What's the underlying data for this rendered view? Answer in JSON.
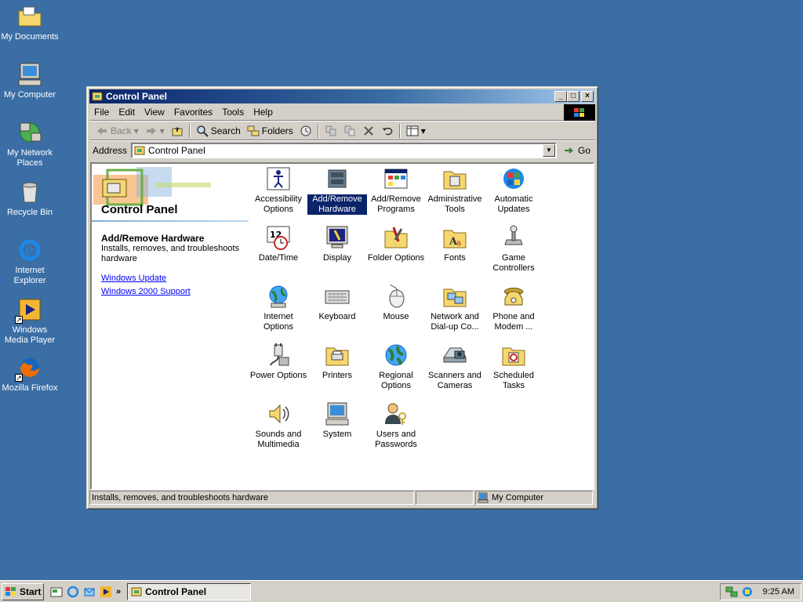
{
  "desktop": {
    "icons": [
      {
        "label": "My Documents"
      },
      {
        "label": "My Computer"
      },
      {
        "label": "My Network Places"
      },
      {
        "label": "Recycle Bin"
      },
      {
        "label": "Internet Explorer"
      },
      {
        "label": "Windows Media Player"
      },
      {
        "label": "Mozilla Firefox"
      }
    ]
  },
  "window": {
    "title": "Control Panel",
    "menu": [
      "File",
      "Edit",
      "View",
      "Favorites",
      "Tools",
      "Help"
    ],
    "toolbar": {
      "back": "Back",
      "search": "Search",
      "folders": "Folders"
    },
    "address": {
      "label": "Address",
      "value": "Control Panel",
      "go": "Go"
    },
    "left_pane": {
      "title": "Control Panel",
      "selected_title": "Add/Remove Hardware",
      "selected_desc": "Installs, removes, and troubleshoots hardware",
      "links": [
        "Windows Update",
        "Windows 2000 Support"
      ]
    },
    "items": [
      {
        "label": "Accessibility Options",
        "icon": "accessibility-icon"
      },
      {
        "label": "Add/Remove Hardware",
        "icon": "hardware-icon",
        "selected": true
      },
      {
        "label": "Add/Remove Programs",
        "icon": "programs-icon"
      },
      {
        "label": "Administrative Tools",
        "icon": "admin-tools-icon"
      },
      {
        "label": "Automatic Updates",
        "icon": "windows-update-icon"
      },
      {
        "label": "Date/Time",
        "icon": "datetime-icon"
      },
      {
        "label": "Display",
        "icon": "display-icon"
      },
      {
        "label": "Folder Options",
        "icon": "folder-options-icon"
      },
      {
        "label": "Fonts",
        "icon": "fonts-icon"
      },
      {
        "label": "Game Controllers",
        "icon": "joystick-icon"
      },
      {
        "label": "Internet Options",
        "icon": "internet-icon"
      },
      {
        "label": "Keyboard",
        "icon": "keyboard-icon"
      },
      {
        "label": "Mouse",
        "icon": "mouse-icon"
      },
      {
        "label": "Network and Dial-up Co...",
        "icon": "network-icon"
      },
      {
        "label": "Phone and Modem ...",
        "icon": "phone-icon"
      },
      {
        "label": "Power Options",
        "icon": "power-icon"
      },
      {
        "label": "Printers",
        "icon": "printer-icon"
      },
      {
        "label": "Regional Options",
        "icon": "globe-icon"
      },
      {
        "label": "Scanners and Cameras",
        "icon": "scanner-icon"
      },
      {
        "label": "Scheduled Tasks",
        "icon": "scheduled-tasks-icon"
      },
      {
        "label": "Sounds and Multimedia",
        "icon": "speaker-icon"
      },
      {
        "label": "System",
        "icon": "computer-icon"
      },
      {
        "label": "Users and Passwords",
        "icon": "users-icon"
      }
    ],
    "status": {
      "text": "Installs, removes, and troubleshoots hardware",
      "zone": "My Computer"
    }
  },
  "taskbar": {
    "start": "Start",
    "task": "Control Panel",
    "clock": "9:25 AM"
  }
}
